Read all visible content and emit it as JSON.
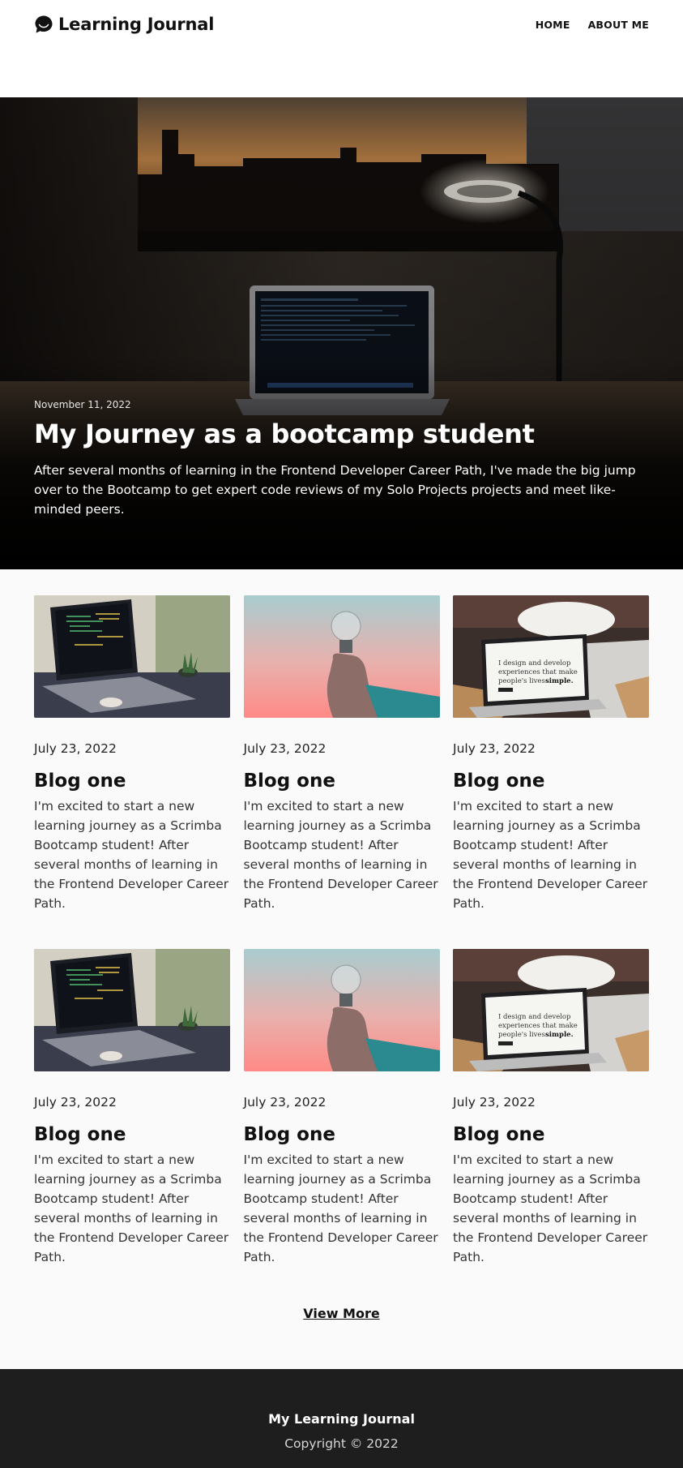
{
  "header": {
    "brand": "Learning Journal",
    "nav": [
      {
        "label": "HOME"
      },
      {
        "label": "ABOUT ME"
      }
    ]
  },
  "hero": {
    "date": "November 11, 2022",
    "title": "My Journey as a bootcamp student",
    "text": "After several months of learning in the Frontend Developer Career Path, I've made the big jump over to the Bootcamp to get expert code reviews of my Solo Projects projects and meet like-minded peers."
  },
  "posts": [
    {
      "image": "laptop-code",
      "date": "July 23, 2022",
      "title": "Blog one",
      "text": "I'm excited to start a new learning journey as a Scrimba Bootcamp student! After several months of learning in the Frontend Developer Career Path."
    },
    {
      "image": "lightbulb",
      "date": "July 23, 2022",
      "title": "Blog one",
      "text": "I'm excited to start a new learning journey as a Scrimba Bootcamp student! After several months of learning in the Frontend Developer Career Path."
    },
    {
      "image": "laptop-design",
      "date": "July 23, 2022",
      "title": "Blog one",
      "text": "I'm excited to start a new learning journey as a Scrimba Bootcamp student! After several months of learning in the Frontend Developer Career Path."
    },
    {
      "image": "laptop-code",
      "date": "July 23, 2022",
      "title": "Blog one",
      "text": "I'm excited to start a new learning journey as a Scrimba Bootcamp student! After several months of learning in the Frontend Developer Career Path."
    },
    {
      "image": "lightbulb",
      "date": "July 23, 2022",
      "title": "Blog one",
      "text": "I'm excited to start a new learning journey as a Scrimba Bootcamp student! After several months of learning in the Frontend Developer Career Path."
    },
    {
      "image": "laptop-design",
      "date": "July 23, 2022",
      "title": "Blog one",
      "text": "I'm excited to start a new learning journey as a Scrimba Bootcamp student! After several months of learning in the Frontend Developer Career Path."
    }
  ],
  "thumb_text": {
    "line1": "I design and develop",
    "line2": "experiences that make",
    "line3": "people's lives",
    "bold": "simple."
  },
  "view_more": "View More",
  "footer": {
    "title": "My Learning Journal",
    "copyright": "Copyright © 2022"
  },
  "colors": {
    "footer_bg": "#1e1e1e",
    "page_bg": "#fafafa",
    "hero_overlay": "#000000"
  }
}
